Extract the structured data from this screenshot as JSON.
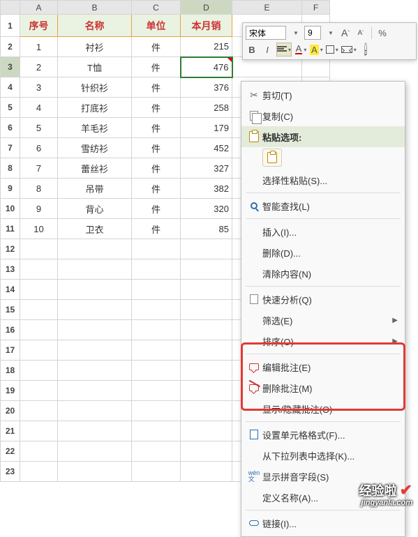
{
  "columns": [
    "A",
    "B",
    "C",
    "D",
    "E",
    "F"
  ],
  "header": {
    "A": "序号",
    "B": "名称",
    "C": "单位",
    "D": "本月销"
  },
  "rows": [
    {
      "n": "1",
      "a": "1",
      "b": "衬衫",
      "c": "件",
      "d": "215"
    },
    {
      "n": "2",
      "a": "2",
      "b": "T恤",
      "c": "件",
      "d": "476"
    },
    {
      "n": "3",
      "a": "3",
      "b": "针织衫",
      "c": "件",
      "d": "376"
    },
    {
      "n": "4",
      "a": "4",
      "b": "打底衫",
      "c": "件",
      "d": "258"
    },
    {
      "n": "5",
      "a": "5",
      "b": "羊毛衫",
      "c": "件",
      "d": "179"
    },
    {
      "n": "6",
      "a": "6",
      "b": "雪纺衫",
      "c": "件",
      "d": "452"
    },
    {
      "n": "7",
      "a": "7",
      "b": "蕾丝衫",
      "c": "件",
      "d": "327"
    },
    {
      "n": "8",
      "a": "8",
      "b": "吊带",
      "c": "件",
      "d": "382"
    },
    {
      "n": "9",
      "a": "9",
      "b": "背心",
      "c": "件",
      "d": "320"
    },
    {
      "n": "10",
      "a": "10",
      "b": "卫衣",
      "c": "件",
      "d": "85"
    }
  ],
  "empty_rows": [
    "12",
    "13",
    "14",
    "15",
    "16",
    "17",
    "18",
    "19",
    "20",
    "21",
    "22",
    "23"
  ],
  "toolbar": {
    "font_name": "宋体",
    "font_size": "9",
    "percent": "%"
  },
  "ctx": {
    "cut": "剪切(T)",
    "copy": "复制(C)",
    "paste_options": "粘贴选项:",
    "paste_special": "选择性粘贴(S)...",
    "smart_lookup": "智能查找(L)",
    "insert": "插入(I)...",
    "delete": "删除(D)...",
    "clear": "清除内容(N)",
    "quick": "快速分析(Q)",
    "filter": "筛选(E)",
    "sort": "排序(O)",
    "edit_comment": "编辑批注(E)",
    "delete_comment": "删除批注(M)",
    "toggle_comment": "显示/隐藏批注(O)",
    "format_cells": "设置单元格格式(F)...",
    "pick_list": "从下拉列表中选择(K)...",
    "show_pinyin": "显示拼音字段(S)",
    "define_name": "定义名称(A)...",
    "hyperlink": "链接(I)..."
  },
  "watermark": {
    "l1": "经验啦",
    "l2": "jingyanla.com"
  }
}
